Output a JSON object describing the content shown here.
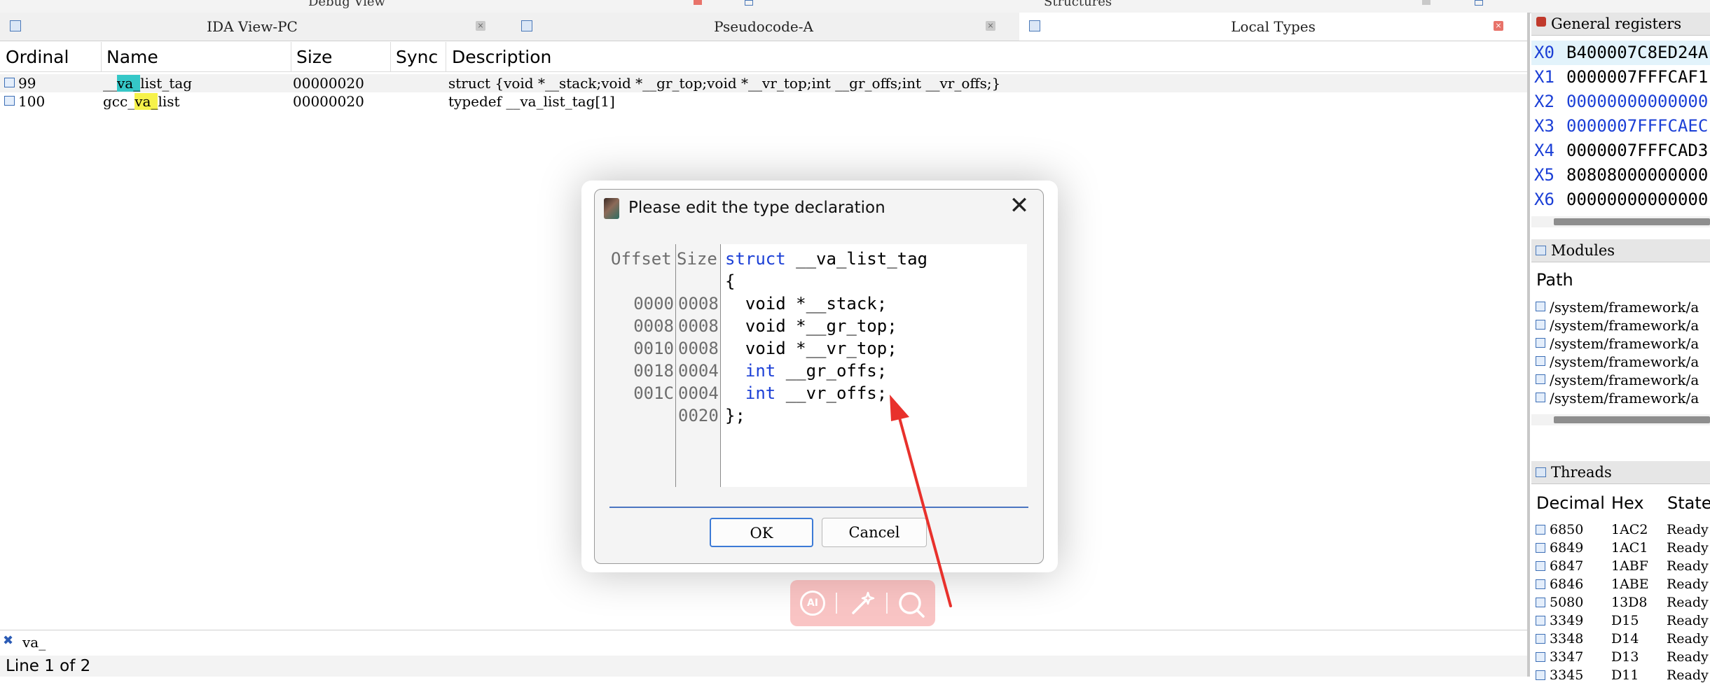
{
  "top_strip": {
    "left_label": "Debug View",
    "right_label": "Structures"
  },
  "tabs": [
    {
      "label": "IDA View-PC",
      "close": "×"
    },
    {
      "label": "Pseudocode-A",
      "close": "×"
    },
    {
      "label": "Local Types",
      "close": "×"
    }
  ],
  "local_types": {
    "columns": [
      "Ordinal",
      "Name",
      "Size",
      "Sync",
      "Description"
    ],
    "rows": [
      {
        "ordinal": "99",
        "name_pre": "__",
        "name_match": "va_",
        "name_post": "list_tag",
        "size": "00000020",
        "sync": "",
        "description": "struct {void *__stack;void *__gr_top;void *__vr_top;int __gr_offs;int __vr_offs;}"
      },
      {
        "ordinal": "100",
        "name_pre": "gcc_",
        "name_match": "va_",
        "name_post": "list",
        "size": "00000020",
        "sync": "",
        "description": "typedef __va_list_tag[1]"
      }
    ],
    "filter_value": "va_",
    "filter_clear": "✖",
    "status": "Line 1 of 2"
  },
  "registers": {
    "title": "General registers",
    "rows": [
      {
        "name": "X0",
        "value": "B400007C8ED24A"
      },
      {
        "name": "X1",
        "value": "0000007FFFCAF1"
      },
      {
        "name": "X2",
        "value": "00000000000000"
      },
      {
        "name": "X3",
        "value": "0000007FFFCAEC"
      },
      {
        "name": "X4",
        "value": "0000007FFFCAD3"
      },
      {
        "name": "X5",
        "value": "80808000000000"
      },
      {
        "name": "X6",
        "value": "00000000000000"
      }
    ]
  },
  "modules": {
    "title": "Modules",
    "column": "Path",
    "rows": [
      "/system/framework/a",
      "/system/framework/a",
      "/system/framework/a",
      "/system/framework/a",
      "/system/framework/a",
      "/system/framework/a"
    ]
  },
  "threads": {
    "title": "Threads",
    "columns": [
      "Decimal",
      "Hex",
      "State"
    ],
    "rows": [
      {
        "decimal": "6850",
        "hex": "1AC2",
        "state": "Ready"
      },
      {
        "decimal": "6849",
        "hex": "1AC1",
        "state": "Ready"
      },
      {
        "decimal": "6847",
        "hex": "1ABF",
        "state": "Ready"
      },
      {
        "decimal": "6846",
        "hex": "1ABE",
        "state": "Ready"
      },
      {
        "decimal": "5080",
        "hex": "13D8",
        "state": "Ready"
      },
      {
        "decimal": "3349",
        "hex": "D15",
        "state": "Ready"
      },
      {
        "decimal": "3348",
        "hex": "D14",
        "state": "Ready"
      },
      {
        "decimal": "3347",
        "hex": "D13",
        "state": "Ready"
      },
      {
        "decimal": "3345",
        "hex": "D11",
        "state": "Ready"
      }
    ]
  },
  "dialog": {
    "title": "Please edit the type declaration",
    "close": "✕",
    "gutter_headers": {
      "offset": "Offset",
      "size": "Size"
    },
    "lines": [
      {
        "offset": "",
        "size": "",
        "kw": "struct",
        "code": " __va_list_tag"
      },
      {
        "offset": "",
        "size": "",
        "kw": "",
        "code": "{"
      },
      {
        "offset": "0000",
        "size": "0008",
        "kw": "",
        "code": "  void *__stack;"
      },
      {
        "offset": "0008",
        "size": "0008",
        "kw": "",
        "code": "  void *__gr_top;"
      },
      {
        "offset": "0010",
        "size": "0008",
        "kw": "",
        "code": "  void *__vr_top;"
      },
      {
        "offset": "0018",
        "size": "0004",
        "kw": "  int",
        "code": " __gr_offs;"
      },
      {
        "offset": "001C",
        "size": "0004",
        "kw": "  int",
        "code": " __vr_offs;"
      },
      {
        "offset": "",
        "size": "0020",
        "kw": "",
        "code": "};"
      }
    ],
    "ok_label": "OK",
    "cancel_label": "Cancel"
  },
  "ai_toolbar": {
    "ai_label": "AI"
  },
  "colors": {
    "keyword": "#1b3fd6",
    "register_name": "#1b3fd6",
    "match_highlight_1": "#35c7c7",
    "match_highlight_2": "#f6f24a",
    "annotation_arrow": "#e8312c",
    "ok_border": "#3c7ad6"
  }
}
